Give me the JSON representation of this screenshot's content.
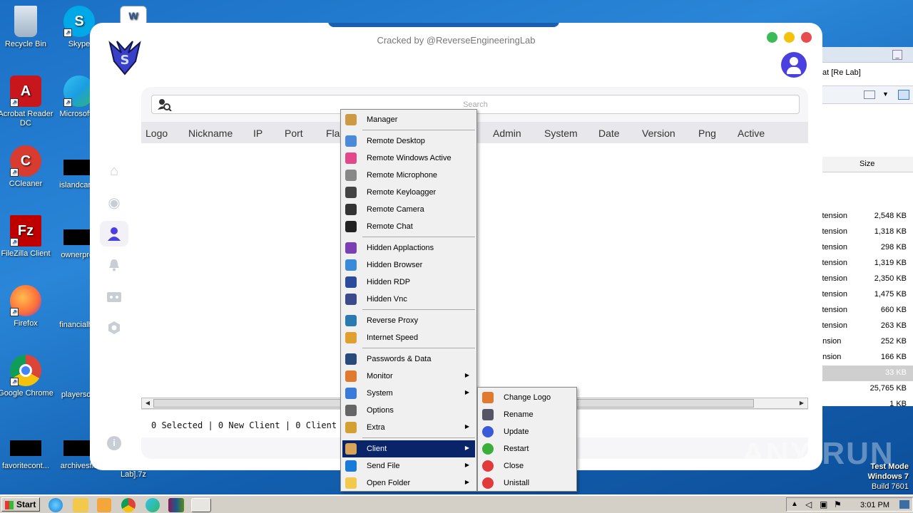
{
  "desktop": {
    "icons": [
      {
        "label": "Recycle Bin"
      },
      {
        "label": "Skype"
      },
      {
        "label": "Acrobat Reader DC"
      },
      {
        "label": "Microsoft E"
      },
      {
        "label": "CCleaner"
      },
      {
        "label": "islandcard.j"
      },
      {
        "label": "FileZilla Client"
      },
      {
        "label": "ownerpres"
      },
      {
        "label": "Firefox"
      },
      {
        "label": "financialhot"
      },
      {
        "label": "Google Chrome"
      },
      {
        "label": "playersdie"
      },
      {
        "label": "favoritecont..."
      },
      {
        "label": "archivesflo"
      },
      {
        "label": "Lab].7z"
      }
    ]
  },
  "explorer": {
    "address": "at [Re Lab]",
    "size_header": "Size",
    "rows": [
      {
        "type": "xtension",
        "size": "2,548 KB"
      },
      {
        "type": "xtension",
        "size": "1,318 KB"
      },
      {
        "type": "xtension",
        "size": "298 KB"
      },
      {
        "type": "xtension",
        "size": "1,319 KB"
      },
      {
        "type": "xtension",
        "size": "2,350 KB"
      },
      {
        "type": "xtension",
        "size": "1,475 KB"
      },
      {
        "type": "xtension",
        "size": "660 KB"
      },
      {
        "type": "xtension",
        "size": "263 KB"
      },
      {
        "type": "ension",
        "size": "252 KB"
      },
      {
        "type": "ension",
        "size": "166 KB"
      },
      {
        "type": "",
        "size": "33 KB"
      },
      {
        "type": "",
        "size": "25,765 KB"
      },
      {
        "type": "",
        "size": "1 KB"
      }
    ]
  },
  "app": {
    "cracked_text": "Cracked by @ReverseEngineeringLab",
    "window_dots": {
      "green": "#3cba54",
      "yellow": "#f4c20d",
      "red": "#e84c4c"
    },
    "accent": "#4a3fe0",
    "search_placeholder": "Search",
    "columns": [
      "Logo",
      "Nickname",
      "IP",
      "Port",
      "Flag",
      "Admin",
      "System",
      "Date",
      "Version",
      "Png",
      "Active"
    ],
    "status_text": "0 Selected | 0 New Client | 0 Client",
    "nav_icons": [
      "home-icon",
      "eye-icon",
      "user-icon",
      "bell-icon",
      "robot-icon",
      "settings-icon"
    ]
  },
  "context_menu": {
    "items": [
      {
        "label": "Manager"
      },
      {
        "label": "Remote Desktop"
      },
      {
        "label": "Remote Windows Active"
      },
      {
        "label": "Remote Microphone"
      },
      {
        "label": "Remote Keyloagger"
      },
      {
        "label": "Remote Camera"
      },
      {
        "label": "Remote Chat"
      },
      {
        "label": "Hidden Applactions"
      },
      {
        "label": "Hidden Browser"
      },
      {
        "label": "Hidden RDP"
      },
      {
        "label": "Hidden Vnc"
      },
      {
        "label": "Reverse Proxy"
      },
      {
        "label": "Internet Speed"
      },
      {
        "label": "Passwords & Data"
      },
      {
        "label": "Monitor"
      },
      {
        "label": "System"
      },
      {
        "label": "Options"
      },
      {
        "label": "Extra"
      },
      {
        "label": "Client"
      },
      {
        "label": "Send File"
      },
      {
        "label": "Open Folder"
      }
    ]
  },
  "client_submenu": {
    "items": [
      {
        "label": "Change Logo"
      },
      {
        "label": "Rename"
      },
      {
        "label": "Update"
      },
      {
        "label": "Restart"
      },
      {
        "label": "Close"
      },
      {
        "label": "Unistall"
      }
    ]
  },
  "watermark": "ANY RUN",
  "test_mode": {
    "line1": "Test Mode",
    "line2": "Windows 7",
    "line3": "Build 7601"
  },
  "taskbar": {
    "start_label": "Start",
    "clock": "3:01 PM"
  }
}
